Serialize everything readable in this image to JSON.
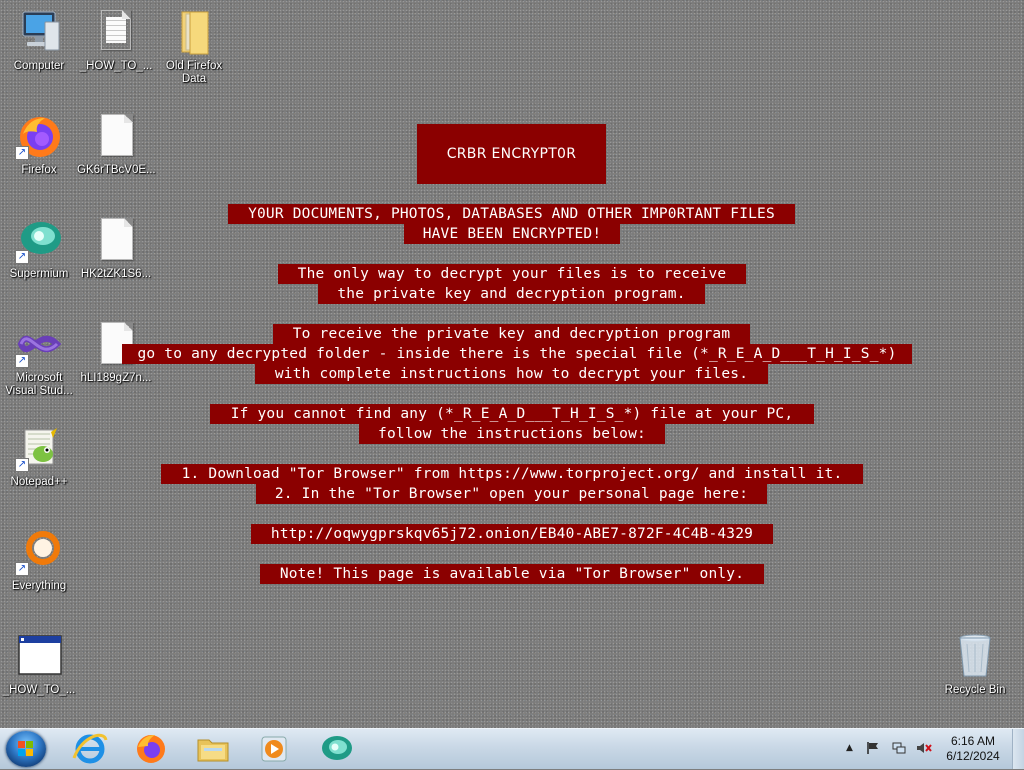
{
  "desktop": {
    "icons": [
      {
        "label": "Computer"
      },
      {
        "label": "_HOW_TO_..."
      },
      {
        "label": "Old Firefox Data"
      },
      {
        "label": "Firefox"
      },
      {
        "label": "GK6rTBcV0E..."
      },
      {
        "label": "Supermium"
      },
      {
        "label": "HK2tZK1S6..."
      },
      {
        "label": "Microsoft Visual Stud..."
      },
      {
        "label": "hLI189gZ7n..."
      },
      {
        "label": "Notepad++"
      },
      {
        "label": "Everything"
      },
      {
        "label": "_HOW_TO_..."
      },
      {
        "label": "Recycle Bin"
      }
    ]
  },
  "note": {
    "title": "CRBR ENCRYPT0R",
    "lines": [
      "Y0UR DOCUMENTS, PHOTOS, DATABASES AND OTHER IMP0RTANT FILES",
      "HAVE BEEN ENCRYPTED!",
      "The only way to decrypt your files is to receive",
      "the private key and decryption program.",
      "To receive the private key and decryption program",
      "go to any decrypted folder - inside there is the special file (*_R_E_A_D___T_H_I_S_*)",
      "with complete instructions how to decrypt your files.",
      "If you cannot find any (*_R_E_A_D___T_H_I_S_*) file at your PC,",
      "follow the instructions below:",
      "1. Download \"Tor Browser\" from https://www.torproject.org/ and install it.",
      "2. In the \"Tor Browser\" open your personal page here:",
      "http://oqwygprskqv65j72.onion/EB40-ABE7-872F-4C4B-4329",
      "Note! This page is available via \"Tor Browser\" only."
    ]
  },
  "taskbar": {
    "clock_time": "6:16 AM",
    "clock_date": "6/12/2024"
  },
  "colors": {
    "note_background": "#8b0000",
    "note_text": "#ffffff"
  }
}
